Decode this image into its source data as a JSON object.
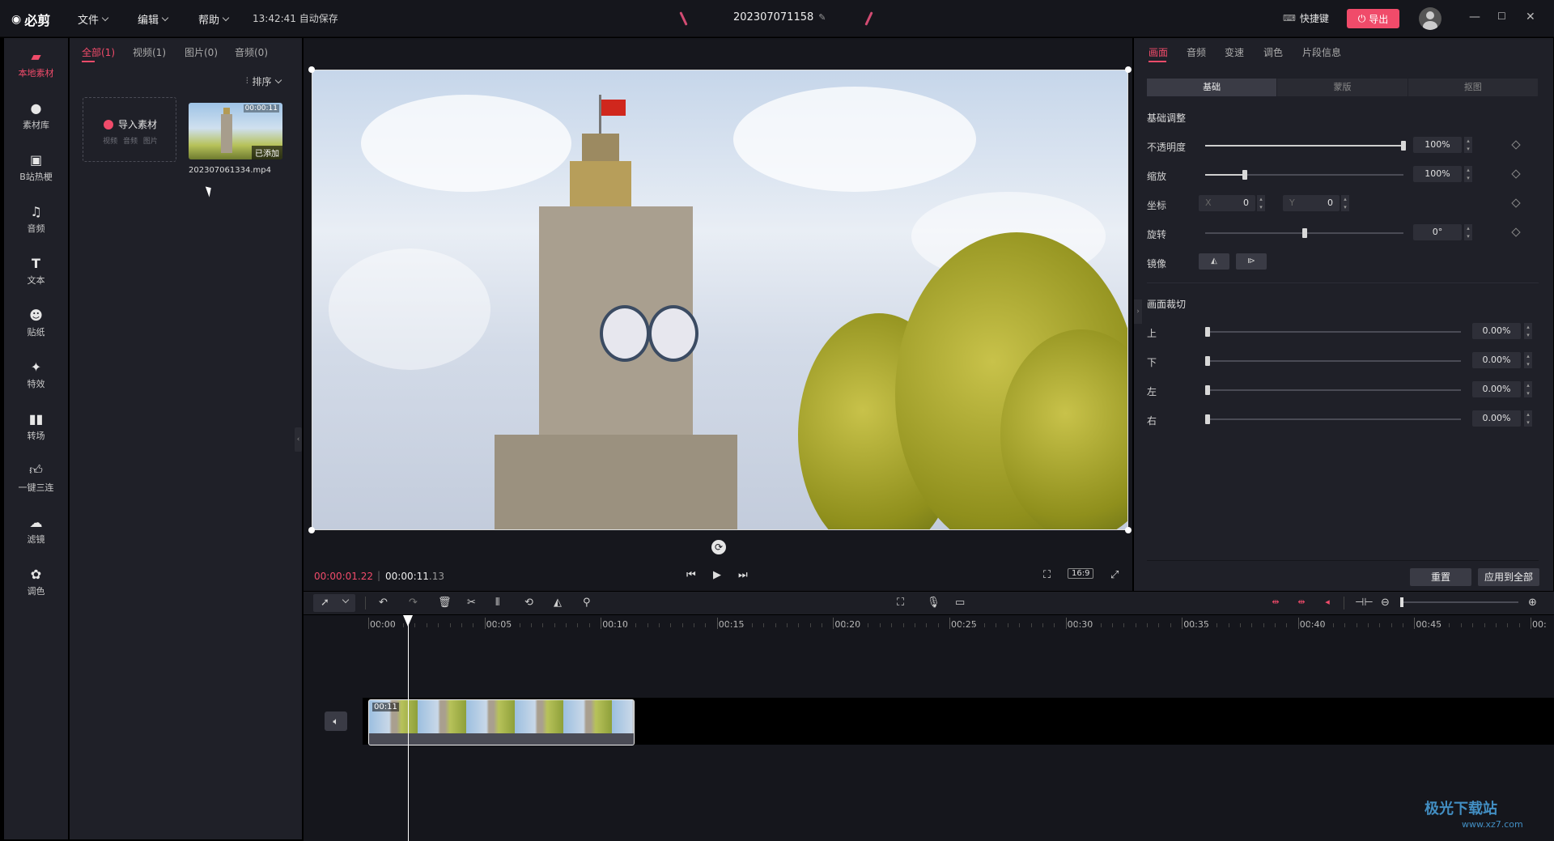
{
  "app": {
    "logo": "必剪",
    "menus": [
      {
        "label": "文件"
      },
      {
        "label": "编辑"
      },
      {
        "label": "帮助"
      }
    ],
    "autosave": "13:42:41 自动保存",
    "project_name": "202307071158",
    "shortcuts_label": "快捷键",
    "export_label": "导出"
  },
  "rail": {
    "items": [
      {
        "label": "本地素材",
        "icon": "folder-icon"
      },
      {
        "label": "素材库",
        "icon": "material-icon"
      },
      {
        "label": "B站热梗",
        "icon": "tv-icon"
      },
      {
        "label": "音频",
        "icon": "music-icon"
      },
      {
        "label": "文本",
        "icon": "text-icon"
      },
      {
        "label": "贴纸",
        "icon": "sticker-icon"
      },
      {
        "label": "特效",
        "icon": "effect-icon"
      },
      {
        "label": "转场",
        "icon": "transition-icon"
      },
      {
        "label": "一键三连",
        "icon": "thumbs-up-icon"
      },
      {
        "label": "滤镜",
        "icon": "filter-icon"
      },
      {
        "label": "调色",
        "icon": "palette-icon"
      }
    ]
  },
  "media": {
    "tabs": [
      {
        "label": "全部(1)"
      },
      {
        "label": "视频(1)"
      },
      {
        "label": "图片(0)"
      },
      {
        "label": "音频(0)"
      }
    ],
    "sort_label": "排序",
    "import_label": "导入素材",
    "import_sub": "视频 音频 图片",
    "clip": {
      "duration": "00:00:11",
      "badge": "已添加",
      "name": "202307061334.mp4"
    }
  },
  "preview": {
    "current_time": "00:00:01",
    "current_frame": ".22",
    "total_time": "00:00:11",
    "total_frame": ".13",
    "ratio": "16:9"
  },
  "props": {
    "tabs": [
      {
        "label": "画面"
      },
      {
        "label": "音频"
      },
      {
        "label": "变速"
      },
      {
        "label": "调色"
      },
      {
        "label": "片段信息"
      }
    ],
    "segments": [
      {
        "label": "基础"
      },
      {
        "label": "蒙版"
      },
      {
        "label": "抠图"
      }
    ],
    "basic_title": "基础调整",
    "opacity": {
      "label": "不透明度",
      "value": "100%",
      "level": 1.0
    },
    "scale": {
      "label": "缩放",
      "value": "100%",
      "level": 0.2
    },
    "position": {
      "label": "坐标",
      "x_key": "X",
      "x": "0",
      "y_key": "Y",
      "y": "0"
    },
    "rotation": {
      "label": "旋转",
      "value": "0°",
      "level": 0.5
    },
    "mirror": {
      "label": "镜像"
    },
    "crop_title": "画面裁切",
    "crop": [
      {
        "label": "上",
        "value": "0.00%"
      },
      {
        "label": "下",
        "value": "0.00%"
      },
      {
        "label": "左",
        "value": "0.00%"
      },
      {
        "label": "右",
        "value": "0.00%"
      }
    ],
    "reset_label": "重置",
    "apply_all_label": "应用到全部"
  },
  "timeline": {
    "ticks": [
      "00:00",
      "00:05",
      "00:10",
      "00:15",
      "00:20",
      "00:25",
      "00:30",
      "00:35",
      "00:40",
      "00:45",
      "00:"
    ],
    "clip_duration": "00:11"
  },
  "watermark": {
    "main": "极光下载站",
    "sub": "www.xz7.com"
  }
}
